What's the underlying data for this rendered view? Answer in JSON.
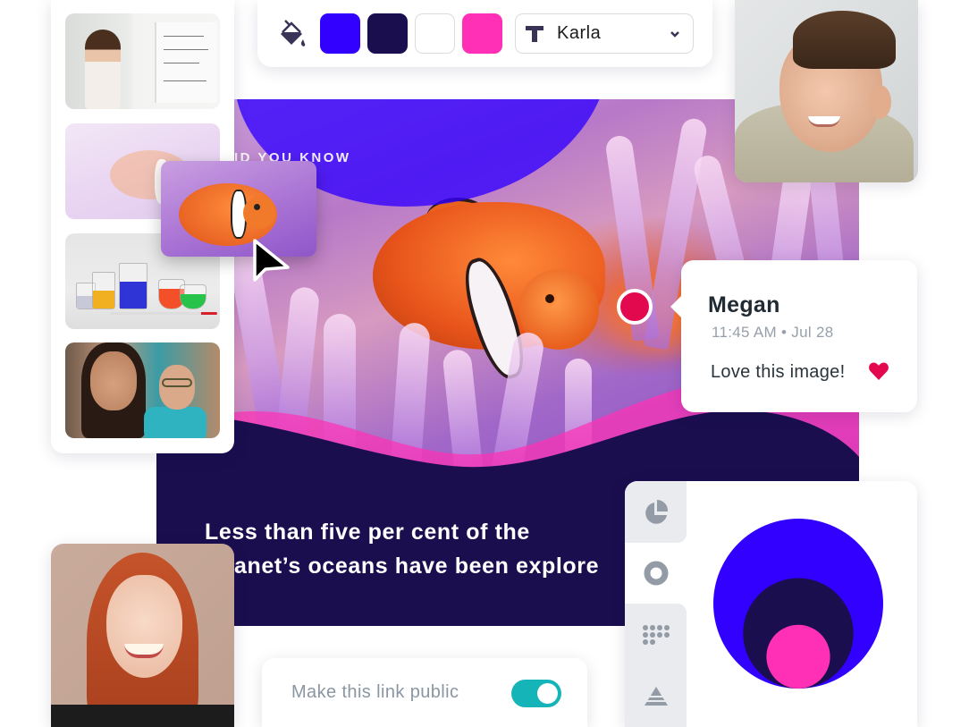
{
  "toolbar": {
    "fill_icon": "paint-bucket-icon",
    "swatches": [
      {
        "name": "blue",
        "color": "#3100ff"
      },
      {
        "name": "navy",
        "color": "#1a0e4f"
      },
      {
        "name": "white",
        "color": "#ffffff"
      },
      {
        "name": "pink",
        "color": "#ff30b5"
      }
    ],
    "font": {
      "icon": "text-t-icon",
      "selected": "Karla",
      "chevron": "chevron-down-icon"
    }
  },
  "thumbnails": [
    {
      "subject": "teacher at whiteboard"
    },
    {
      "subject": "clownfish slide (faded)"
    },
    {
      "subject": "lab beakers"
    },
    {
      "subject": "smiling students"
    }
  ],
  "slide": {
    "eyebrow": "ID YOU KNOW",
    "fact_line1": "Less than five per cent of the",
    "fact_line2": "anet’s oceans have been explore",
    "colors": {
      "background": "#1a0e4f",
      "blob": "#3100ff",
      "wave": "#ff30b5"
    }
  },
  "comment": {
    "author": "Megan",
    "time": "11:45 AM",
    "separator": "•",
    "date": "Jul 28",
    "text": "Love this image!",
    "marker_color": "#e3094f",
    "reaction": "heart-icon"
  },
  "chart_picker": {
    "tabs": [
      {
        "name": "pie-chart",
        "icon": "pie-chart-icon",
        "active": false
      },
      {
        "name": "donut-chart",
        "icon": "donut-chart-icon",
        "active": true
      },
      {
        "name": "dot-matrix",
        "icon": "dot-grid-icon",
        "active": false
      },
      {
        "name": "pyramid",
        "icon": "pyramid-icon",
        "active": false
      }
    ],
    "preview_circles": [
      {
        "color": "#3100ff",
        "relative_size": 1.0
      },
      {
        "color": "#1a0e4f",
        "relative_size": 0.65
      },
      {
        "color": "#ff30b5",
        "relative_size": 0.375
      }
    ]
  },
  "share": {
    "label": "Make this link public",
    "enabled": true,
    "toggle_color": "#14b4b9"
  },
  "people": [
    {
      "name": "smiling-boy-avatar"
    },
    {
      "name": "smiling-redhead-avatar"
    }
  ]
}
